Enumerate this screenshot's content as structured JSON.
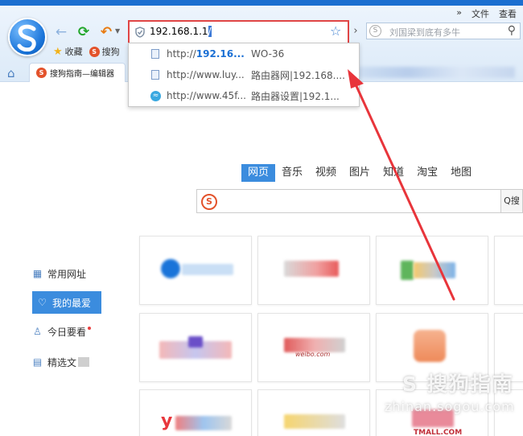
{
  "window": {
    "menu": {
      "expand": "»",
      "file": "文件",
      "view": "查看"
    },
    "colors": {
      "accent": "#3b8cde",
      "highlight_border": "#e04545",
      "topstrip": "#1b6fd0"
    }
  },
  "toolbar": {
    "back_icon": "←",
    "refresh_icon": "⟳",
    "undo_icon": "↶",
    "address_value": "192.168.1.1",
    "address_cursor": "/",
    "star_icon": "☆",
    "go_icon": "›",
    "search_placeholder": "刘国梁到底有多牛",
    "search_icon": "⚲"
  },
  "favorites": [
    {
      "label": "收藏"
    },
    {
      "label": "搜狗"
    }
  ],
  "tabs": {
    "home_icon": "⌂",
    "active_tab": "搜狗指南—编辑器"
  },
  "suggestions": [
    {
      "prefix": "http://",
      "bold": "192.16...",
      "title": "WO-36",
      "icon": "doc"
    },
    {
      "prefix": "http://www.luy...",
      "bold": "",
      "title": "路由器网|192.168....",
      "icon": "doc"
    },
    {
      "prefix": "http://www.45f...",
      "bold": "",
      "title": "路由器设置|192.1...",
      "icon": "globe"
    }
  ],
  "main": {
    "categories": [
      "网页",
      "音乐",
      "视频",
      "图片",
      "知道",
      "淘宝",
      "地图"
    ],
    "active_category": 0,
    "search_button": "Q搜"
  },
  "sidebar": [
    {
      "label": "常用网址",
      "icon": "grid-icon"
    },
    {
      "label": "我的最爱",
      "icon": "heart-icon",
      "active": true
    },
    {
      "label": "今日要看",
      "icon": "person-icon"
    },
    {
      "label": "精选文",
      "icon": "doc-icon"
    }
  ],
  "tiles": [
    {
      "caption": ""
    },
    {
      "caption": "搜狐"
    },
    {
      "caption": ""
    },
    {
      "caption": ""
    },
    {
      "caption": ""
    },
    {
      "caption": "weibo.com"
    },
    {
      "caption": ""
    },
    {
      "caption": ""
    },
    {
      "caption": "y"
    },
    {
      "caption": ""
    },
    {
      "caption": "TMALL.COM"
    },
    {
      "caption": ""
    }
  ],
  "watermark": {
    "line1": "S 搜狗指南",
    "line2": "zhinan.sogou.com"
  }
}
